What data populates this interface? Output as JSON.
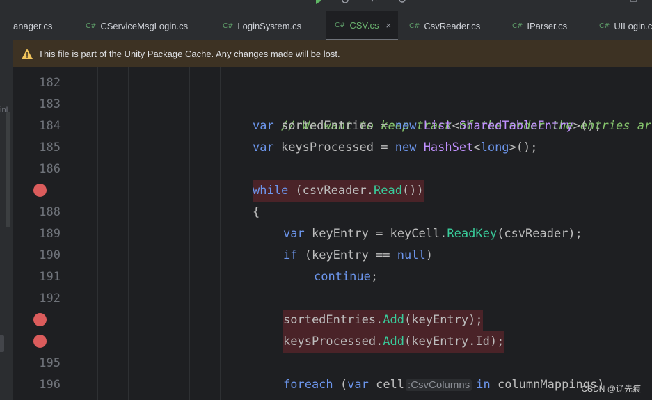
{
  "tabs": [
    {
      "label": "anager.cs",
      "lang": "C#"
    },
    {
      "label": "CServiceMsgLogin.cs",
      "lang": "C#"
    },
    {
      "label": "LoginSystem.cs",
      "lang": "C#"
    },
    {
      "label": "CSV.cs",
      "lang": "C#",
      "active": true,
      "close": "×"
    },
    {
      "label": "CsvReader.cs",
      "lang": "C#"
    },
    {
      "label": "IParser.cs",
      "lang": "C#"
    },
    {
      "label": "UILogin.cs",
      "lang": "C#"
    }
  ],
  "left_strip_cut_text": "inI",
  "banner": {
    "text": "This file is part of the Unity Package Cache. Any changes made will be lost.",
    "icon": "warning-icon"
  },
  "gutter": {
    "lines": [
      "182",
      "183",
      "184",
      "185",
      "186",
      "",
      "188",
      "189",
      "190",
      "191",
      "192",
      "",
      "",
      "195",
      "196"
    ],
    "breakpoint_lines": [
      "187",
      "193",
      "194"
    ]
  },
  "code": {
    "l183_comment": "// We want to keep track of the order the entries are",
    "l184": {
      "kw1": "var",
      "p1": " sortedEntries = ",
      "kw2": "new",
      "t1": "List",
      "p2": "<",
      "t2": "SharedTableEntry",
      "p3": ">();"
    },
    "l185": {
      "kw1": "var",
      "p1": " keysProcessed = ",
      "kw2": "new",
      "t1": "HashSet",
      "p2": "<",
      "kw3": "long",
      "p3": ">();"
    },
    "l187": {
      "kw1": "while",
      "p1": " (csvReader.",
      "m1": "Read",
      "p2": "())"
    },
    "l188": "{",
    "l189": {
      "kw1": "var",
      "p1": " keyEntry = keyCell.",
      "m1": "ReadKey",
      "p2": "(csvReader);"
    },
    "l190": {
      "kw1": "if",
      "p1": " (keyEntry == ",
      "kw2": "null",
      "p2": ")"
    },
    "l191": {
      "kw1": "continue",
      "p1": ";"
    },
    "l193": {
      "p1": "sortedEntries.",
      "m1": "Add",
      "p2": "(keyEntry);"
    },
    "l194": {
      "p1": "keysProcessed.",
      "m1": "Add",
      "p2": "(keyEntry.Id);"
    },
    "l196": {
      "kw1": "foreach",
      "p1": " (",
      "kw2": "var",
      "p2": " cell",
      "hint": ":CsvColumns",
      "kw3": "in",
      "p3": " columnMappings)"
    }
  },
  "watermark": "CSDN @辽先痕",
  "colors": {
    "keyword": "#6c95eb",
    "comment": "#85c46c",
    "type": "#c191ff",
    "method": "#39cc9b",
    "breakpoint": "#db5c5c",
    "breakpoint_line_bg": "#4a2328",
    "banner_bg": "#3d3223",
    "active_tab_text": "#6bb36f"
  }
}
